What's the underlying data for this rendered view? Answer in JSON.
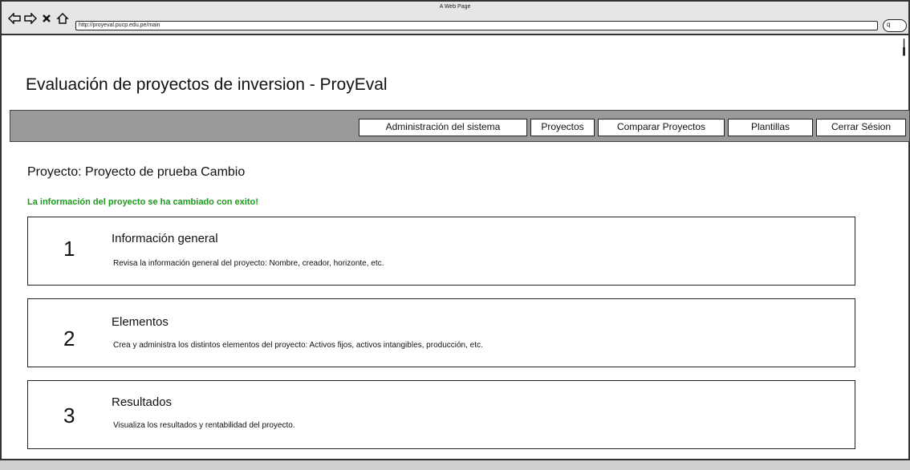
{
  "browser": {
    "window_title": "A Web Page",
    "url": "http://proyeval.pucp.edu.pe/main",
    "search_glyph": "q"
  },
  "app": {
    "title": "Evaluación de proyectos de inversion - ProyEval"
  },
  "menu": {
    "items": [
      {
        "label": "Administración del sistema"
      },
      {
        "label": "Proyectos"
      },
      {
        "label": "Comparar Proyectos"
      },
      {
        "label": "Plantillas"
      },
      {
        "label": "Cerrar Sésion"
      }
    ]
  },
  "project": {
    "title": "Proyecto: Proyecto de prueba Cambio",
    "success_message": "La información del proyecto se ha cambiado con exito!",
    "success_color": "#1c9a1c"
  },
  "cards": [
    {
      "number": "1",
      "title": "Información general",
      "description": "Revisa la información general del proyecto: Nombre, creador, horizonte, etc."
    },
    {
      "number": "2",
      "title": "Elementos",
      "description": "Crea y administra los distintos elementos del proyecto: Activos fijos, activos intangibles, producción, etc."
    },
    {
      "number": "3",
      "title": "Resultados",
      "description": "Visualiza los resultados y rentabilidad del proyecto."
    }
  ],
  "colors": {
    "menubar": "#999999",
    "chrome": "#e6e6e6"
  }
}
